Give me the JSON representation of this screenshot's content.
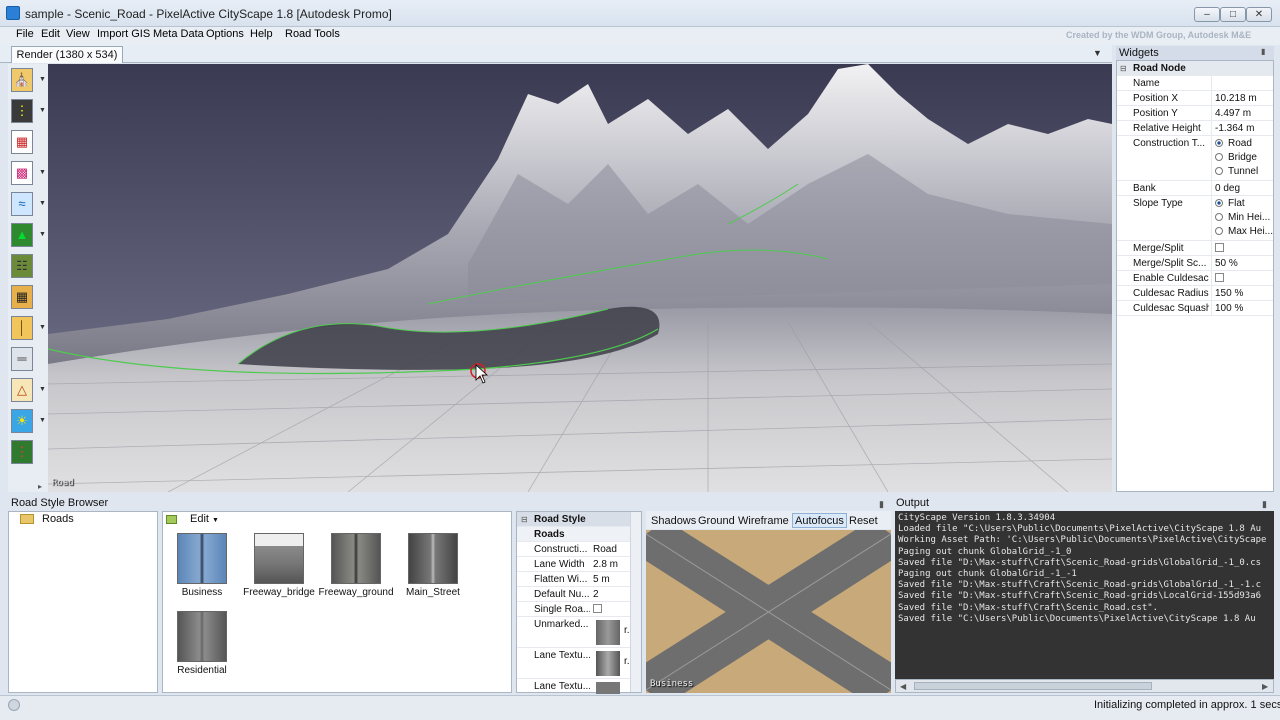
{
  "window": {
    "title": "sample - Scenic_Road - PixelActive CityScape 1.8 [Autodesk Promo]",
    "icon": "app-icon",
    "controls": [
      "minimize-icon",
      "maximize-icon",
      "close-icon"
    ]
  },
  "menu": [
    "File",
    "Edit",
    "View",
    "Import GIS",
    "Meta Data",
    "Options",
    "Help",
    "Road Tools"
  ],
  "credit": "Created by the WDM Group, Autodesk M&E",
  "render_tab": "Render (1380 x 534)",
  "viewport_label": "Road",
  "tools": [
    "building-tool-icon",
    "road-tool-icon",
    "block-tool-icon",
    "lot-tool-icon",
    "water-tool-icon",
    "tree-tool-icon",
    "fence-tool-icon",
    "building-grid-icon",
    "pole-tool-icon",
    "rail-tool-icon",
    "terrain-tool-icon",
    "light-tool-icon",
    "traffic-light-icon"
  ],
  "widgets": {
    "header": "Widgets",
    "section": "Road Node",
    "props": [
      {
        "name": "Name",
        "value": ""
      },
      {
        "name": "Position X",
        "value": "10.218 m"
      },
      {
        "name": "Position Y",
        "value": "4.497 m"
      },
      {
        "name": "Relative Height",
        "value": "-1.364 m"
      },
      {
        "name": "Construction T...",
        "options": [
          "Road",
          "Bridge",
          "Tunnel"
        ],
        "selected": "Road"
      },
      {
        "name": "Bank",
        "value": "0 deg"
      },
      {
        "name": "Slope Type",
        "options": [
          "Flat",
          "Min Hei...",
          "Max Hei..."
        ],
        "selected": "Flat"
      },
      {
        "name": "Merge/Split",
        "checked": false
      },
      {
        "name": "Merge/Split Sc...",
        "value": "50 %"
      },
      {
        "name": "Enable Culdesac",
        "checked": false
      },
      {
        "name": "Culdesac Radius",
        "value": "150 %"
      },
      {
        "name": "Culdesac Squash",
        "value": "100 %"
      }
    ]
  },
  "road_style_browser": {
    "header": "Road Style Browser",
    "tree_item": "Roads",
    "edit_label": "Edit",
    "items": [
      "Business",
      "Freeway_bridge",
      "Freeway_ground",
      "Main_Street",
      "Residential"
    ]
  },
  "road_style_props": {
    "section": "Road Style",
    "subsection": "Roads",
    "props": [
      {
        "name": "Constructi...",
        "value": "Road"
      },
      {
        "name": "Lane Width",
        "value": "2.8 m"
      },
      {
        "name": "Flatten Wi...",
        "value": "5 m"
      },
      {
        "name": "Default Nu...",
        "value": "2"
      },
      {
        "name": "Single Roa...",
        "checked": false
      },
      {
        "name": "Unmarked...",
        "value": "r."
      },
      {
        "name": "Lane Textu...",
        "value": "r."
      },
      {
        "name": "Lane Textu...",
        "value": ""
      }
    ]
  },
  "preview": {
    "buttons": [
      "Shadows",
      "Ground",
      "Wireframe",
      "Autofocus",
      "Reset"
    ],
    "active": "Autofocus",
    "label": "Business"
  },
  "output": {
    "header": "Output",
    "lines": [
      "CityScape Version 1.8.3.34904",
      "Loaded file \"C:\\Users\\Public\\Documents\\PixelActive\\CityScape 1.8 Au",
      "Working Asset Path: 'C:\\Users\\Public\\Documents\\PixelActive\\CityScape",
      "Paging out chunk GlobalGrid_-1_0",
      "Saved file \"D:\\Max-stuff\\Craft\\Scenic_Road-grids\\GlobalGrid_-1_0.cs",
      "Paging out chunk GlobalGrid_-1_-1",
      "Saved file \"D:\\Max-stuff\\Craft\\Scenic_Road-grids\\GlobalGrid_-1_-1.c",
      "Saved file \"D:\\Max-stuff\\Craft\\Scenic_Road-grids\\LocalGrid-155d93a6",
      "Saved file \"D:\\Max-stuff\\Craft\\Scenic_Road.cst\".",
      "Saved file \"C:\\Users\\Public\\Documents\\PixelActive\\CityScape 1.8 Au"
    ]
  },
  "status": {
    "text": "Initializing completed in approx. 1 secs."
  }
}
